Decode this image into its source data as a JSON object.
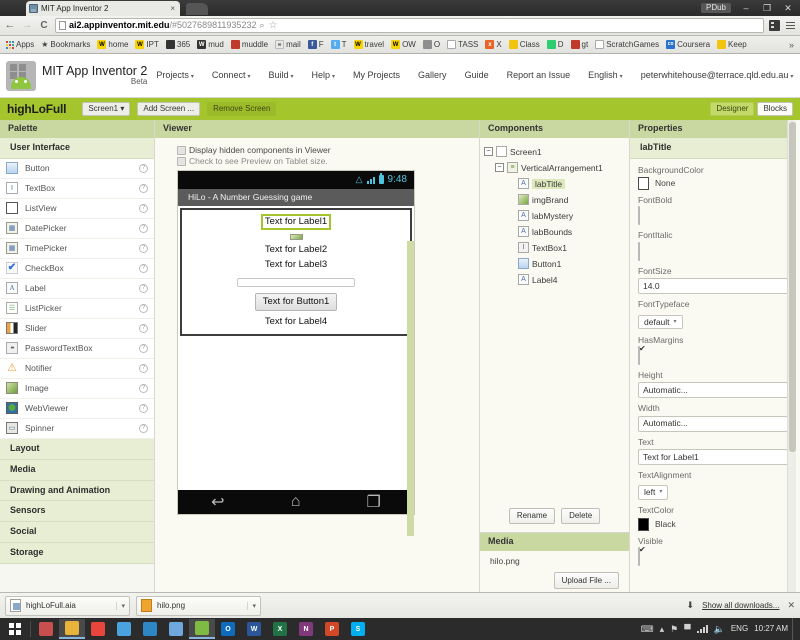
{
  "browser": {
    "tab_title": "MIT App Inventor 2",
    "tab_close": "×",
    "url_host": "ai2.appinventor.mit.edu",
    "url_path": "/#5027689811935232",
    "back_icon": "←",
    "forward_icon": "→",
    "reload_icon": "C",
    "star_icon": "☆",
    "magnify_icon": "⌕",
    "window_user": "PDub",
    "minimize": "–",
    "restore": "❐",
    "close": "✕",
    "bookmarks": [
      {
        "label": "Apps",
        "icon": "apps-grid-icon",
        "style": "apps"
      },
      {
        "label": "Bookmarks",
        "icon": "star-icon",
        "style": "star"
      },
      {
        "label": "home",
        "icon": "w-icon",
        "style": "ico-W",
        "glyph": "W"
      },
      {
        "label": "IPT",
        "icon": "w-icon",
        "style": "ico-W",
        "glyph": "W"
      },
      {
        "label": "365",
        "icon": "office-icon",
        "style": "ico-dark",
        "glyph": ""
      },
      {
        "label": "mud",
        "icon": "w-icon",
        "style": "ico-dark",
        "glyph": "W"
      },
      {
        "label": "muddle",
        "icon": "moodle-icon",
        "style": "ico-red",
        "glyph": ""
      },
      {
        "label": "mail",
        "icon": "mail-icon",
        "style": "ico-mail",
        "glyph": "✉"
      },
      {
        "label": "F",
        "icon": "facebook-icon",
        "style": "ico-fb",
        "glyph": "f"
      },
      {
        "label": "T",
        "icon": "twitter-icon",
        "style": "ico-tw",
        "glyph": "t"
      },
      {
        "label": "travel",
        "icon": "w-icon",
        "style": "ico-W",
        "glyph": "W"
      },
      {
        "label": "OW",
        "icon": "w-icon",
        "style": "ico-W",
        "glyph": "W"
      },
      {
        "label": "O",
        "icon": "plug-icon",
        "style": "ico-gray",
        "glyph": ""
      },
      {
        "label": "TASS",
        "icon": "page-icon",
        "style": "ico-doc",
        "glyph": ""
      },
      {
        "label": "X",
        "icon": "excel-icon",
        "style": "ico-orange",
        "glyph": "x"
      },
      {
        "label": "Class",
        "icon": "classroom-icon",
        "style": "ico-yellow",
        "glyph": ""
      },
      {
        "label": "D",
        "icon": "lightning-icon",
        "style": "ico-green",
        "glyph": ""
      },
      {
        "label": "gt",
        "icon": "gt-icon",
        "style": "ico-red",
        "glyph": ""
      },
      {
        "label": "ScratchGames",
        "icon": "page-icon",
        "style": "ico-doc",
        "glyph": ""
      },
      {
        "label": "Coursera",
        "icon": "coursera-icon",
        "style": "ico-coursera",
        "glyph": "co"
      },
      {
        "label": "Keep",
        "icon": "keep-icon",
        "style": "ico-yellow",
        "glyph": ""
      }
    ],
    "bookmarks_overflow": "»"
  },
  "appinventor": {
    "logo_title": "MIT App Inventor 2",
    "logo_beta": "Beta",
    "topnav": [
      {
        "label": "Projects",
        "caret": true
      },
      {
        "label": "Connect",
        "caret": true
      },
      {
        "label": "Build",
        "caret": true
      },
      {
        "label": "Help",
        "caret": true
      }
    ],
    "topnav_right": [
      {
        "label": "My Projects",
        "caret": false
      },
      {
        "label": "Gallery",
        "caret": false
      },
      {
        "label": "Guide",
        "caret": false
      },
      {
        "label": "Report an Issue",
        "caret": false
      },
      {
        "label": "English",
        "caret": true
      },
      {
        "label": "peterwhitehouse@terrace.qld.edu.au",
        "caret": true
      }
    ],
    "caret_glyph": "▾"
  },
  "projectbar": {
    "project_name": "highLoFull",
    "screen_selector": "Screen1",
    "add_screen": "Add Screen ...",
    "remove_screen": "Remove Screen",
    "designer": "Designer",
    "blocks": "Blocks"
  },
  "palette": {
    "header": "Palette",
    "open_category": "User Interface",
    "items": [
      {
        "label": "Button",
        "icon": "button-icon",
        "cls": "i-button",
        "glyph": ""
      },
      {
        "label": "TextBox",
        "icon": "textbox-icon",
        "cls": "i-textbox",
        "glyph": "I"
      },
      {
        "label": "ListView",
        "icon": "listview-icon",
        "cls": "i-listview",
        "glyph": ""
      },
      {
        "label": "DatePicker",
        "icon": "datepicker-icon",
        "cls": "i-picker",
        "glyph": "▦"
      },
      {
        "label": "TimePicker",
        "icon": "timepicker-icon",
        "cls": "i-picker",
        "glyph": "▦"
      },
      {
        "label": "CheckBox",
        "icon": "checkbox-icon",
        "cls": "i-check",
        "glyph": "✔"
      },
      {
        "label": "Label",
        "icon": "label-icon",
        "cls": "i-label",
        "glyph": "A"
      },
      {
        "label": "ListPicker",
        "icon": "listpicker-icon",
        "cls": "i-listpicker",
        "glyph": "☰"
      },
      {
        "label": "Slider",
        "icon": "slider-icon",
        "cls": "i-slider",
        "glyph": ""
      },
      {
        "label": "PasswordTextBox",
        "icon": "password-icon",
        "cls": "i-pass",
        "glyph": "••"
      },
      {
        "label": "Notifier",
        "icon": "notifier-icon",
        "cls": "i-notifier",
        "glyph": "⚠"
      },
      {
        "label": "Image",
        "icon": "image-icon",
        "cls": "i-image",
        "glyph": ""
      },
      {
        "label": "WebViewer",
        "icon": "webviewer-icon",
        "cls": "i-web",
        "glyph": ""
      },
      {
        "label": "Spinner",
        "icon": "spinner-icon",
        "cls": "i-spinner",
        "glyph": "▭"
      }
    ],
    "help_glyph": "?",
    "categories": [
      "Layout",
      "Media",
      "Drawing and Animation",
      "Sensors",
      "Social",
      "Storage"
    ]
  },
  "viewer": {
    "header": "Viewer",
    "checkbox_hidden": "Display hidden components in Viewer",
    "checkbox_tablet": "Check to see Preview on Tablet size.",
    "phone": {
      "status_time": "9:48",
      "app_title": "HiLo - A Number Guessing game",
      "label1": "Text for Label1",
      "label2": "Text for Label2",
      "label3": "Text for Label3",
      "button1": "Text for Button1",
      "label4": "Text for Label4",
      "nav_back": "↩",
      "nav_home": "⌂",
      "nav_recent": "❐"
    }
  },
  "components": {
    "header": "Components",
    "tree": [
      {
        "label": "Screen1",
        "depth": 0,
        "expander": "−",
        "icon": "screen-icon",
        "cls": "v-screen",
        "glyph": "",
        "selected": false
      },
      {
        "label": "VerticalArrangement1",
        "depth": 1,
        "expander": "−",
        "icon": "vertical-arrangement-icon",
        "cls": "v-varr",
        "glyph": "≡",
        "selected": false
      },
      {
        "label": "labTitle",
        "depth": 2,
        "expander": "",
        "icon": "label-icon",
        "cls": "",
        "glyph": "A",
        "selected": true
      },
      {
        "label": "imgBrand",
        "depth": 2,
        "expander": "",
        "icon": "image-icon",
        "cls": "v-img",
        "glyph": "",
        "selected": false
      },
      {
        "label": "labMystery",
        "depth": 2,
        "expander": "",
        "icon": "label-icon",
        "cls": "",
        "glyph": "A",
        "selected": false
      },
      {
        "label": "labBounds",
        "depth": 2,
        "expander": "",
        "icon": "label-icon",
        "cls": "",
        "glyph": "A",
        "selected": false
      },
      {
        "label": "TextBox1",
        "depth": 2,
        "expander": "",
        "icon": "textbox-icon",
        "cls": "v-txt",
        "glyph": "I",
        "selected": false
      },
      {
        "label": "Button1",
        "depth": 2,
        "expander": "",
        "icon": "button-icon",
        "cls": "v-btn",
        "glyph": "",
        "selected": false
      },
      {
        "label": "Label4",
        "depth": 2,
        "expander": "",
        "icon": "label-icon",
        "cls": "",
        "glyph": "A",
        "selected": false
      }
    ],
    "rename": "Rename",
    "delete": "Delete"
  },
  "media": {
    "header": "Media",
    "files": [
      "hilo.png"
    ],
    "upload": "Upload File ..."
  },
  "properties": {
    "header": "Properties",
    "selected_component": "labTitle",
    "rows": [
      {
        "label": "BackgroundColor",
        "type": "color",
        "value": "None",
        "swatch": "white"
      },
      {
        "label": "FontBold",
        "type": "check",
        "value": "",
        "checked": false
      },
      {
        "label": "FontItalic",
        "type": "check",
        "value": "",
        "checked": false
      },
      {
        "label": "FontSize",
        "type": "input",
        "value": "14.0"
      },
      {
        "label": "FontTypeface",
        "type": "select",
        "value": "default"
      },
      {
        "label": "HasMargins",
        "type": "check",
        "value": "",
        "checked": true
      },
      {
        "label": "Height",
        "type": "input",
        "value": "Automatic..."
      },
      {
        "label": "Width",
        "type": "input",
        "value": "Automatic..."
      },
      {
        "label": "Text",
        "type": "input",
        "value": "Text for Label1"
      },
      {
        "label": "TextAlignment",
        "type": "select",
        "value": "left"
      },
      {
        "label": "TextColor",
        "type": "color",
        "value": "Black",
        "swatch": "black"
      },
      {
        "label": "Visible",
        "type": "check",
        "value": "",
        "checked": true
      }
    ]
  },
  "downloads": {
    "items": [
      {
        "name": "highLoFull.aia",
        "icon": "aia-file-icon",
        "cls": "aia"
      },
      {
        "name": "hilo.png",
        "icon": "png-file-icon",
        "cls": "png"
      }
    ],
    "caret": "▾",
    "show_all": "Show all downloads...",
    "close": "✕",
    "arrow": "⬇"
  },
  "taskbar": {
    "items": [
      {
        "name": "start-button",
        "glyph": "",
        "color": "#0078d7",
        "active": false
      },
      {
        "name": "apps-grid",
        "glyph": "",
        "color": "#c94f4f",
        "active": false
      },
      {
        "name": "file-explorer",
        "glyph": "",
        "color": "#e8b33a",
        "active": true
      },
      {
        "name": "chrome",
        "glyph": "",
        "color": "#e8453c",
        "active": false
      },
      {
        "name": "paint",
        "glyph": "",
        "color": "#4aa3df",
        "active": false
      },
      {
        "name": "link-tool",
        "glyph": "",
        "color": "#2f86c5",
        "active": false
      },
      {
        "name": "snipping-tool",
        "glyph": "",
        "color": "#6fa8dc",
        "active": false
      },
      {
        "name": "onenote-green",
        "glyph": "",
        "color": "#7fba42",
        "active": true
      },
      {
        "name": "outlook",
        "glyph": "O",
        "color": "#0f6cbd",
        "active": false
      },
      {
        "name": "word",
        "glyph": "W",
        "color": "#2b579a",
        "active": false
      },
      {
        "name": "excel",
        "glyph": "X",
        "color": "#217346",
        "active": false
      },
      {
        "name": "onenote",
        "glyph": "N",
        "color": "#80397b",
        "active": false
      },
      {
        "name": "powerpoint",
        "glyph": "P",
        "color": "#d24726",
        "active": false
      },
      {
        "name": "skype",
        "glyph": "S",
        "color": "#00aff0",
        "active": false
      }
    ],
    "tray": {
      "keyboard_icon": "⌨",
      "up_icon": "▴",
      "flag_icon": "⚑",
      "battery_icon": "▀",
      "volume_icon": "◂",
      "language": "ENG",
      "clock": "10:27 AM"
    }
  }
}
